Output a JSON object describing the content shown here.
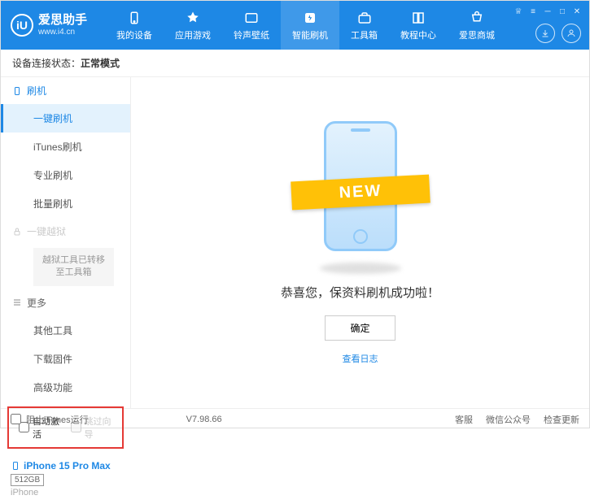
{
  "logo": {
    "icon_text": "iU",
    "title": "爱思助手",
    "url": "www.i4.cn"
  },
  "nav": [
    {
      "label": "我的设备"
    },
    {
      "label": "应用游戏"
    },
    {
      "label": "铃声壁纸"
    },
    {
      "label": "智能刷机"
    },
    {
      "label": "工具箱"
    },
    {
      "label": "教程中心"
    },
    {
      "label": "爱思商城"
    }
  ],
  "status": {
    "label": "设备连接状态：",
    "value": "正常模式"
  },
  "sidebar": {
    "section_flash": "刷机",
    "items_flash": [
      "一键刷机",
      "iTunes刷机",
      "专业刷机",
      "批量刷机"
    ],
    "section_jailbreak": "一键越狱",
    "jailbreak_note": "越狱工具已转移至工具箱",
    "section_more": "更多",
    "items_more": [
      "其他工具",
      "下载固件",
      "高级功能"
    ]
  },
  "checkboxes": {
    "auto_activate": "自动激活",
    "skip_guide": "跳过向导"
  },
  "device": {
    "name": "iPhone 15 Pro Max",
    "storage": "512GB",
    "type": "iPhone"
  },
  "main": {
    "banner": "NEW",
    "success": "恭喜您，保资料刷机成功啦！",
    "ok": "确定",
    "log_link": "查看日志"
  },
  "footer": {
    "block_itunes": "阻止iTunes运行",
    "version": "V7.98.66",
    "links": [
      "客服",
      "微信公众号",
      "检查更新"
    ]
  }
}
